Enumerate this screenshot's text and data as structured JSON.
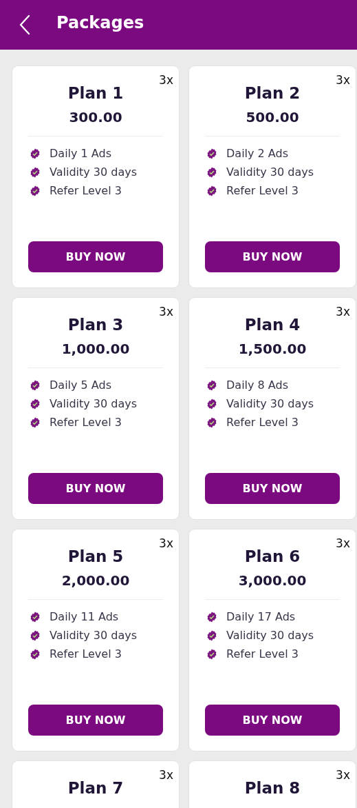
{
  "header": {
    "title": "Packages"
  },
  "plans": [
    {
      "badge": "3x",
      "name": "Plan 1",
      "price": "300.00",
      "features": [
        "Daily 1 Ads",
        "Validity 30 days",
        "Refer Level 3"
      ],
      "button": "BUY NOW"
    },
    {
      "badge": "3x",
      "name": "Plan 2",
      "price": "500.00",
      "features": [
        "Daily 2 Ads",
        "Validity 30 days",
        "Refer Level 3"
      ],
      "button": "BUY NOW"
    },
    {
      "badge": "3x",
      "name": "Plan 3",
      "price": "1,000.00",
      "features": [
        "Daily 5 Ads",
        "Validity 30 days",
        "Refer Level 3"
      ],
      "button": "BUY NOW"
    },
    {
      "badge": "3x",
      "name": "Plan 4",
      "price": "1,500.00",
      "features": [
        "Daily 8 Ads",
        "Validity 30 days",
        "Refer Level 3"
      ],
      "button": "BUY NOW"
    },
    {
      "badge": "3x",
      "name": "Plan 5",
      "price": "2,000.00",
      "features": [
        "Daily 11 Ads",
        "Validity 30 days",
        "Refer Level 3"
      ],
      "button": "BUY NOW"
    },
    {
      "badge": "3x",
      "name": "Plan 6",
      "price": "3,000.00",
      "features": [
        "Daily 17 Ads",
        "Validity 30 days",
        "Refer Level 3"
      ],
      "button": "BUY NOW"
    },
    {
      "badge": "3x",
      "name": "Plan 7"
    },
    {
      "badge": "3x",
      "name": "Plan 8"
    }
  ]
}
